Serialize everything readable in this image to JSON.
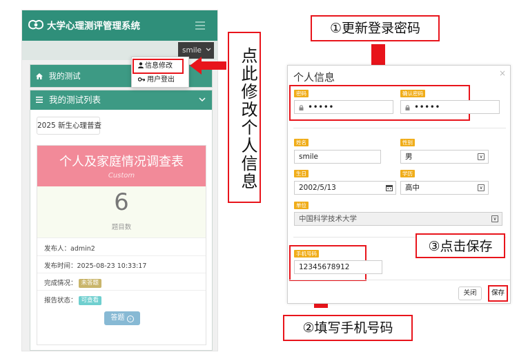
{
  "app": {
    "title": "大学心理测评管理系统",
    "user": "smile"
  },
  "menu": {
    "edit_info": "信息修改",
    "logout": "用户登出"
  },
  "cards": {
    "my_tests": "我的测试",
    "my_test_list": "我的测试列表"
  },
  "survey": {
    "tab_label": "2025 新生心理普查",
    "title": "个人及家庭情况调查表",
    "subtitle": "Custom",
    "question_count": "6",
    "question_count_label": "题目数",
    "publisher": "发布人：admin2",
    "publish_time": "发布时间：2025-08-23 10:33:17",
    "completion_label": "完成情况：",
    "completion_value": "未答题",
    "report_label": "报告状态：",
    "report_value": "可查看",
    "answer_button": "答题"
  },
  "annotations": {
    "vertical": "点此修改个人信息",
    "step1": "①更新登录密码",
    "step2": "②填写手机号码",
    "step3": "③点击保存"
  },
  "dialog": {
    "title": "个人信息",
    "close_symbol": "×",
    "password_label": "密码",
    "password_value": "•••••",
    "confirm_label": "确认密码",
    "confirm_value": "•••••",
    "name_label": "姓名",
    "name_value": "smile",
    "gender_label": "性别",
    "gender_value": "男",
    "birth_label": "生日",
    "birth_value": "2002/5/13",
    "education_label": "学历",
    "education_value": "高中",
    "org_label": "单位",
    "org_value": "中国科学技术大学",
    "phone_label": "手机号码",
    "phone_value": "12345678912",
    "close_button": "关闭",
    "save_button": "保存"
  },
  "colors": {
    "brand_green": "#3d9a84",
    "appbar_green": "#2f8f7a",
    "annotation_red": "#e8141b",
    "label_orange": "#f0ad1a",
    "banner_pink": "#f28a99",
    "badge_unanswered": "#c9b56b",
    "badge_viewable": "#6fcfcf"
  },
  "icons": [
    "psychology-logo-icon",
    "hamburger-icon",
    "chevron-down-icon",
    "home-icon",
    "list-icon",
    "user-icon",
    "key-icon",
    "lock-icon",
    "calendar-icon",
    "arrow-circle-right-icon"
  ]
}
